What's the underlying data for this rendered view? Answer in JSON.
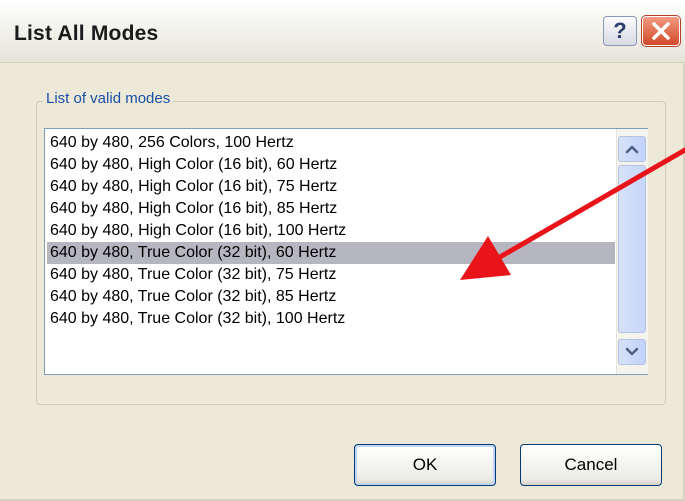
{
  "window": {
    "title": "List All Modes",
    "help_glyph": "?",
    "icons": {
      "help": "help-icon",
      "close": "close-icon"
    }
  },
  "group": {
    "label": "List of valid modes"
  },
  "modes": {
    "items": [
      "640 by 480, 256 Colors, 100 Hertz",
      "640 by 480, High Color (16 bit), 60 Hertz",
      "640 by 480, High Color (16 bit), 75 Hertz",
      "640 by 480, High Color (16 bit), 85 Hertz",
      "640 by 480, High Color (16 bit), 100 Hertz",
      "640 by 480, True Color (32 bit), 60 Hertz",
      "640 by 480, True Color (32 bit), 75 Hertz",
      "640 by 480, True Color (32 bit), 85 Hertz",
      "640 by 480, True Color (32 bit), 100 Hertz"
    ],
    "selected_index": 5
  },
  "scrollbar": {
    "icons": {
      "up": "chevron-up-icon",
      "down": "chevron-down-icon"
    }
  },
  "buttons": {
    "ok": "OK",
    "cancel": "Cancel"
  },
  "annotation": {
    "type": "red-arrow",
    "color": "#e8141a",
    "points_to": "640 by 480, True Color (32 bit), 60 Hertz"
  }
}
